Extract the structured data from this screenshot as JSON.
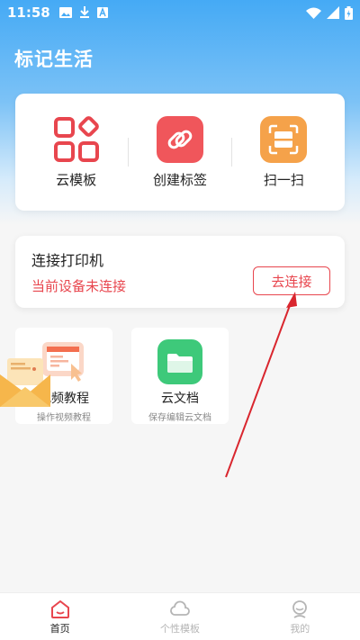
{
  "status_bar": {
    "time": "11:58",
    "left_icons": [
      "image-icon",
      "download-icon",
      "a-badge-icon"
    ],
    "right_icons": [
      "wifi-icon",
      "signal-icon",
      "battery-icon"
    ]
  },
  "header": {
    "title": "标记生活"
  },
  "tools": [
    {
      "label": "云模板",
      "icon": "grid-template-icon",
      "color": "#e8464e"
    },
    {
      "label": "创建标签",
      "icon": "link-icon",
      "color": "#f0565b"
    },
    {
      "label": "扫一扫",
      "icon": "scan-icon",
      "color": "#f5a24a"
    }
  ],
  "printer": {
    "title": "连接打印机",
    "status": "当前设备未连接",
    "connect_label": "去连接",
    "accent": "#e8464e"
  },
  "features": [
    {
      "title": "视频教程",
      "subtitle": "操作视频教程",
      "icon": "video-tutorial-icon"
    },
    {
      "title": "云文档",
      "subtitle": "保存编辑云文档",
      "icon": "folder-icon",
      "color": "#3ec97a"
    }
  ],
  "tabs": [
    {
      "label": "首页",
      "icon": "home-icon",
      "active": true,
      "color": "#e8464e"
    },
    {
      "label": "个性模板",
      "icon": "cloud-icon",
      "active": false,
      "color": "#b5b5b5"
    },
    {
      "label": "我的",
      "icon": "profile-icon",
      "active": false,
      "color": "#b5b5b5"
    }
  ]
}
